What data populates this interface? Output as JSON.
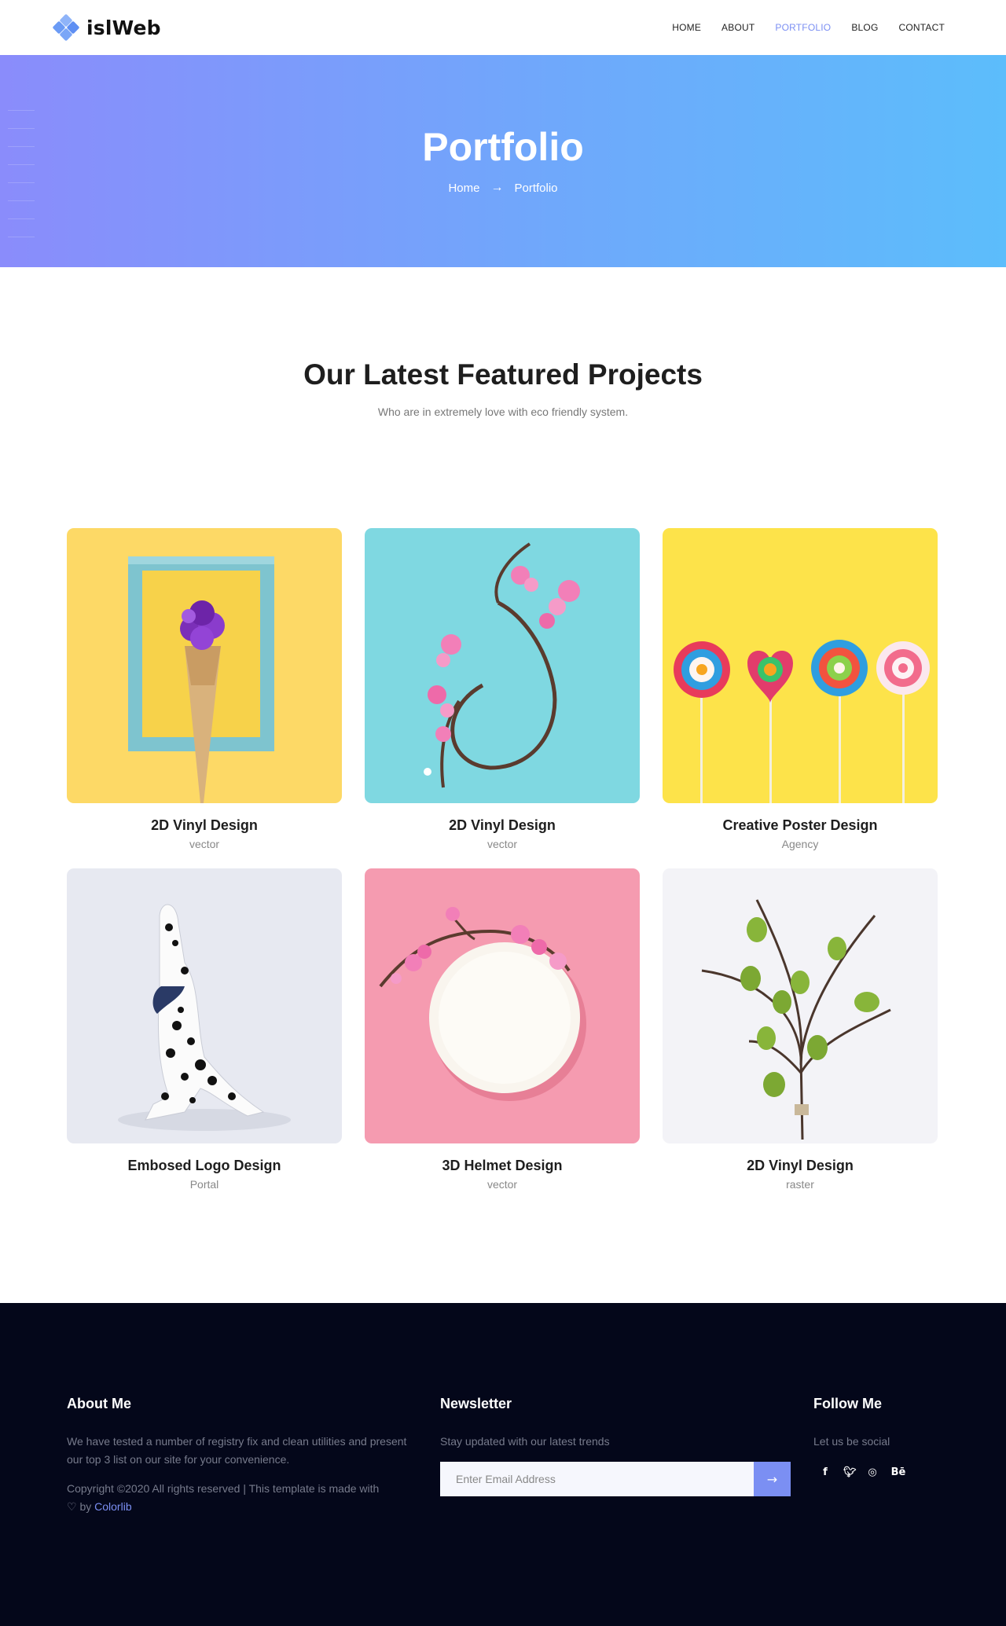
{
  "header": {
    "logo_text": "islWeb",
    "nav": [
      {
        "label": "HOME",
        "active": false
      },
      {
        "label": "ABOUT",
        "active": false
      },
      {
        "label": "PORTFOLIO",
        "active": true
      },
      {
        "label": "BLOG",
        "active": false
      },
      {
        "label": "CONTACT",
        "active": false
      }
    ]
  },
  "banner": {
    "title": "Portfolio",
    "breadcrumb": {
      "home": "Home",
      "current": "Portfolio"
    }
  },
  "section": {
    "title": "Our Latest Featured Projects",
    "subtitle": "Who are in extremely love with eco friendly system."
  },
  "projects": [
    {
      "title": "2D Vinyl Design",
      "category": "vector",
      "image": "ice-cream-cone-frame"
    },
    {
      "title": "2D Vinyl Design",
      "category": "vector",
      "image": "flower-wreath-blue"
    },
    {
      "title": "Creative Poster Design",
      "category": "Agency",
      "image": "lollipops-yellow"
    },
    {
      "title": "Embosed Logo Design",
      "category": "Portal",
      "image": "dalmatian-dog"
    },
    {
      "title": "3D Helmet Design",
      "category": "vector",
      "image": "plate-flowers-pink"
    },
    {
      "title": "2D Vinyl Design",
      "category": "raster",
      "image": "green-eggs-branch"
    }
  ],
  "footer": {
    "about": {
      "title": "About Me",
      "text": "We have tested a number of registry fix and clean utilities and present our top 3 list on our site for your convenience.",
      "copyright": "Copyright ©2020 All rights reserved | This template is made with",
      "by": "by",
      "credit": "Colorlib"
    },
    "newsletter": {
      "title": "Newsletter",
      "text": "Stay updated with our latest trends",
      "placeholder": "Enter Email Address",
      "submit_icon": "arrow-right-icon"
    },
    "follow": {
      "title": "Follow Me",
      "text": "Let us be social",
      "icons": [
        "facebook-icon",
        "twitter-icon",
        "dribbble-icon",
        "behance-icon"
      ]
    }
  },
  "colors": {
    "accent": "#7b8ff3",
    "banner_start": "#8a8cfb",
    "banner_end": "#5cbdfb",
    "footer_bg": "#04071a"
  }
}
